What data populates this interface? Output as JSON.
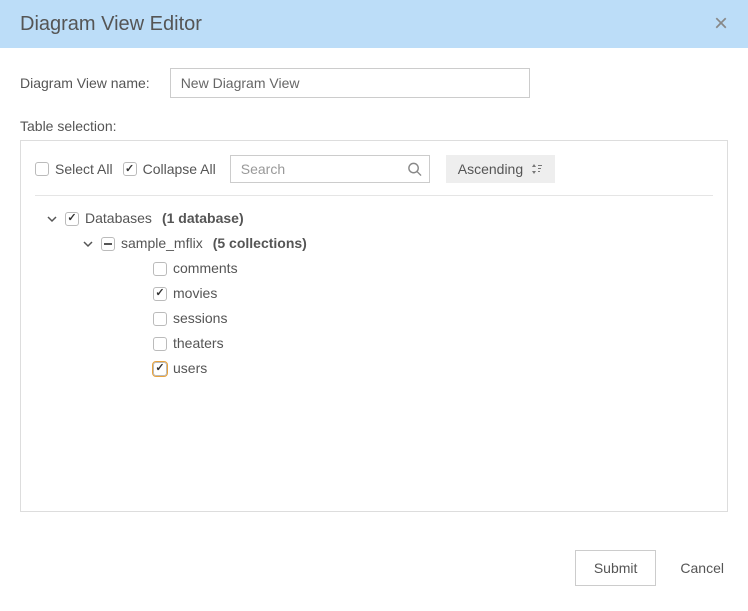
{
  "header": {
    "title": "Diagram View Editor"
  },
  "name_field": {
    "label": "Diagram View name:",
    "value": "New Diagram View"
  },
  "section_label": "Table selection:",
  "controls": {
    "select_all": {
      "label": "Select All",
      "checked": false
    },
    "collapse_all": {
      "label": "Collapse All",
      "checked": true
    },
    "search_placeholder": "Search",
    "sort_label": "Ascending"
  },
  "tree": {
    "root": {
      "label": "Databases",
      "count_label": "(1 database)",
      "expanded": true,
      "checked": true
    },
    "db": {
      "label": "sample_mflix",
      "count_label": "(5 collections)",
      "expanded": true,
      "checked": "mixed"
    },
    "collections": [
      {
        "label": "comments",
        "checked": false,
        "highlight": false
      },
      {
        "label": "movies",
        "checked": true,
        "highlight": false
      },
      {
        "label": "sessions",
        "checked": false,
        "highlight": false
      },
      {
        "label": "theaters",
        "checked": false,
        "highlight": false
      },
      {
        "label": "users",
        "checked": true,
        "highlight": true
      }
    ]
  },
  "footer": {
    "submit": "Submit",
    "cancel": "Cancel"
  }
}
